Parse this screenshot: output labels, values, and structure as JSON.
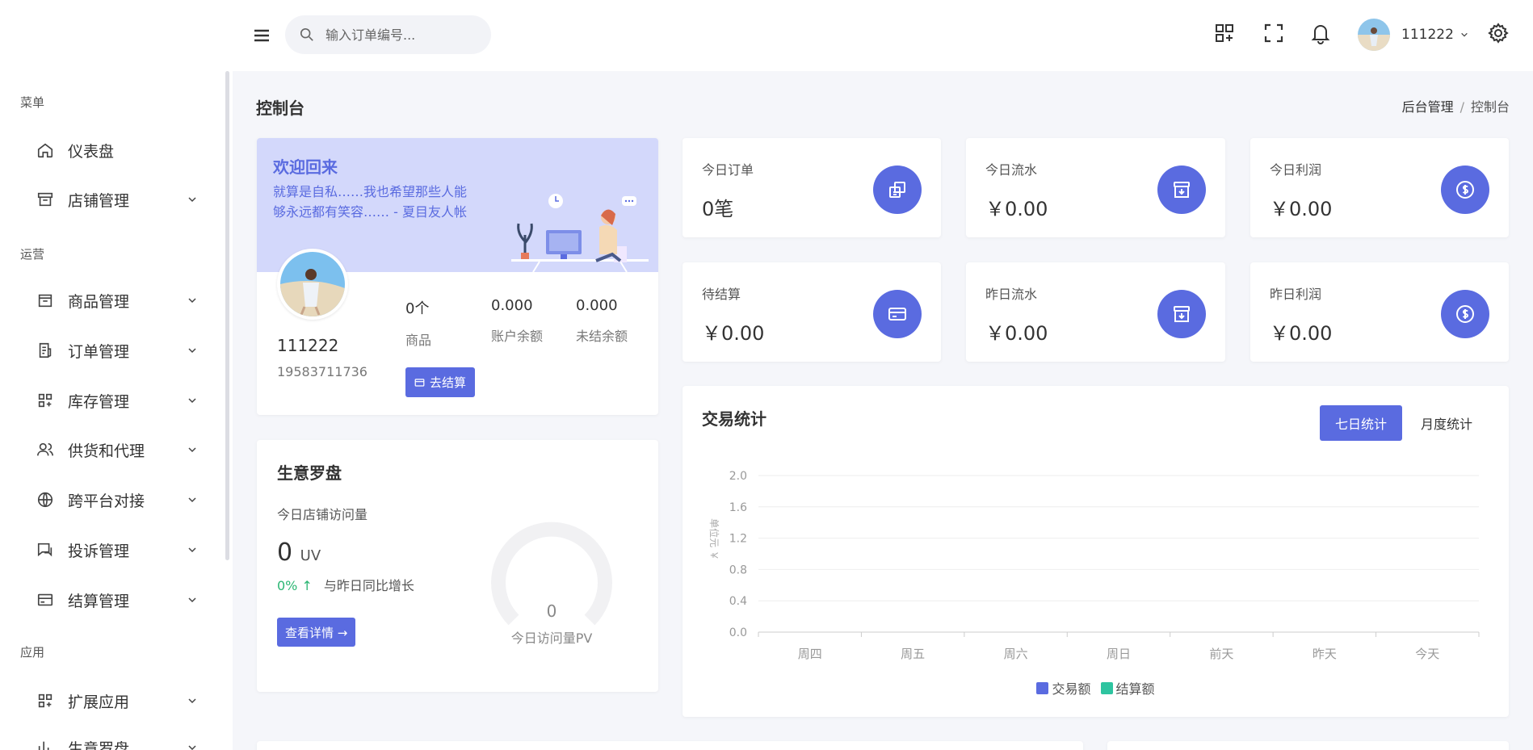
{
  "colors": {
    "accent": "#5a6be0",
    "success": "#2bb673",
    "settle": "#2ec4a0"
  },
  "sidebar": {
    "groups": [
      {
        "label": "菜单"
      },
      {
        "label": "运营"
      },
      {
        "label": "应用"
      }
    ],
    "items": [
      {
        "label": "仪表盘",
        "icon": "home-icon"
      },
      {
        "label": "店铺管理",
        "icon": "store-icon"
      },
      {
        "label": "商品管理",
        "icon": "box-icon"
      },
      {
        "label": "订单管理",
        "icon": "order-icon"
      },
      {
        "label": "库存管理",
        "icon": "grid-icon"
      },
      {
        "label": "供货和代理",
        "icon": "users-icon"
      },
      {
        "label": "跨平台对接",
        "icon": "globe-icon"
      },
      {
        "label": "投诉管理",
        "icon": "chat-icon"
      },
      {
        "label": "结算管理",
        "icon": "card-icon"
      },
      {
        "label": "扩展应用",
        "icon": "grid-icon"
      },
      {
        "label": "生意罗盘",
        "icon": "chart-icon"
      }
    ]
  },
  "header": {
    "search_placeholder": "输入订单编号...",
    "user_name": "111222"
  },
  "page": {
    "title": "控制台",
    "breadcrumb": [
      "后台管理",
      "控制台"
    ]
  },
  "welcome": {
    "title": "欢迎回来",
    "quote": "就算是自私……我也希望那些人能够永远都有笑容…… - 夏目友人帐",
    "name": "111222",
    "phone": "19583711736",
    "stats": [
      {
        "value": "0个",
        "label": "商品"
      },
      {
        "value": "0.000",
        "label": "账户余额"
      },
      {
        "value": "0.000",
        "label": "未结余额"
      }
    ],
    "settle_button": "去结算"
  },
  "stat_cards": [
    {
      "label": "今日订单",
      "value": "0笔",
      "icon": "copy-icon"
    },
    {
      "label": "今日流水",
      "value": "￥0.00",
      "icon": "archive-icon"
    },
    {
      "label": "今日利润",
      "value": "￥0.00",
      "icon": "dollar-icon"
    },
    {
      "label": "待结算",
      "value": "￥0.00",
      "icon": "credit-card-icon"
    },
    {
      "label": "昨日流水",
      "value": "￥0.00",
      "icon": "archive-icon"
    },
    {
      "label": "昨日利润",
      "value": "￥0.00",
      "icon": "dollar-icon"
    }
  ],
  "business": {
    "title": "生意罗盘",
    "subtitle": "今日店铺访问量",
    "uv_value": "0",
    "uv_unit": "UV",
    "growth_pct": "0% ↑",
    "growth_label": "与昨日同比增长",
    "detail_button": "查看详情 →",
    "gauge_value": "0",
    "gauge_label": "今日访问量PV"
  },
  "chart": {
    "title": "交易统计",
    "tabs": [
      {
        "label": "七日统计",
        "active": true
      },
      {
        "label": "月度统计",
        "active": false
      }
    ]
  },
  "chart_data": {
    "type": "bar",
    "ylabel": "单位元 ￥",
    "categories": [
      "周四",
      "周五",
      "周六",
      "周日",
      "前天",
      "昨天",
      "今天"
    ],
    "yticks": [
      "0.0",
      "0.4",
      "0.8",
      "1.2",
      "1.6",
      "2.0"
    ],
    "ylim": [
      0,
      2.0
    ],
    "series": [
      {
        "name": "交易额",
        "values": [
          0,
          0,
          0,
          0,
          0,
          0,
          0
        ],
        "color": "#5a6be0"
      },
      {
        "name": "结算额",
        "values": [
          0,
          0,
          0,
          0,
          0,
          0,
          0
        ],
        "color": "#2ec4a0"
      }
    ],
    "legend": "bottom",
    "grid": true
  }
}
